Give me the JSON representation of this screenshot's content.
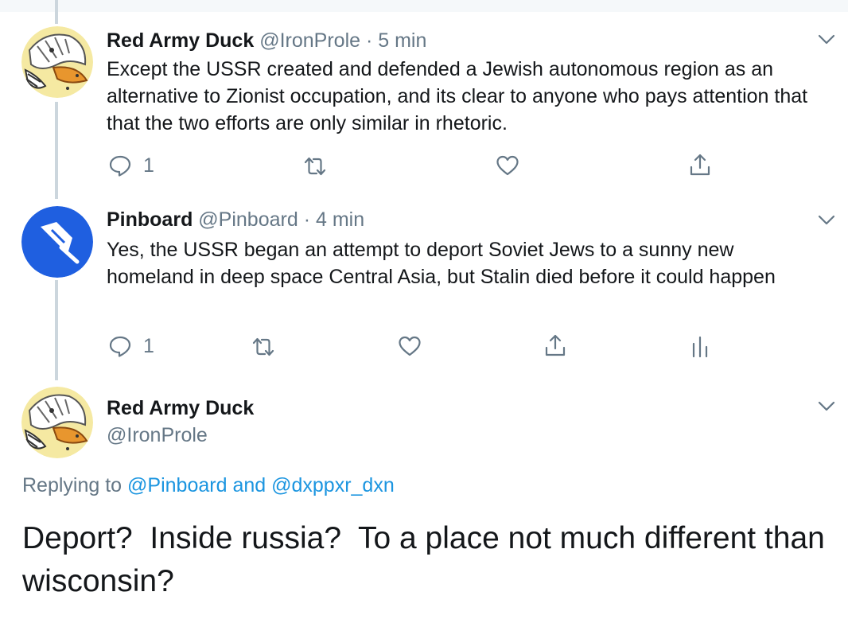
{
  "tweets": [
    {
      "name": "Red Army Duck",
      "handle": "@IronProle",
      "time": "· 5 min",
      "text": "Except the USSR created and defended a Jewish autonomous region as an alternative to Zionist occupation, and its clear to anyone who pays attention that that the two efforts are only similar in rhetoric.",
      "reply_count": "1"
    },
    {
      "name": "Pinboard",
      "handle": "@Pinboard",
      "time": "· 4 min",
      "text": "Yes, the USSR began an attempt to deport Soviet Jews to a sunny new homeland in deep space Central Asia, but Stalin died before it could happen",
      "reply_count": "1"
    }
  ],
  "focused": {
    "name": "Red Army Duck",
    "handle": "@IronProle",
    "replying_label": "Replying to",
    "reply_user_1": "@Pinboard",
    "reply_and": "and",
    "reply_user_2": "@dxppxr_dxn",
    "text": "Deport?  Inside russia?  To a place not much different than wisconsin?"
  },
  "colors": {
    "text": "#14171a",
    "secondary": "#657786",
    "link": "#1b95e0",
    "thread_line": "#ccd6dd",
    "pinboard_blue": "#1f5fe0"
  },
  "icons": [
    "reply-icon",
    "retweet-icon",
    "like-icon",
    "share-icon",
    "analytics-icon",
    "chevron-down-icon",
    "pushpin-icon"
  ]
}
